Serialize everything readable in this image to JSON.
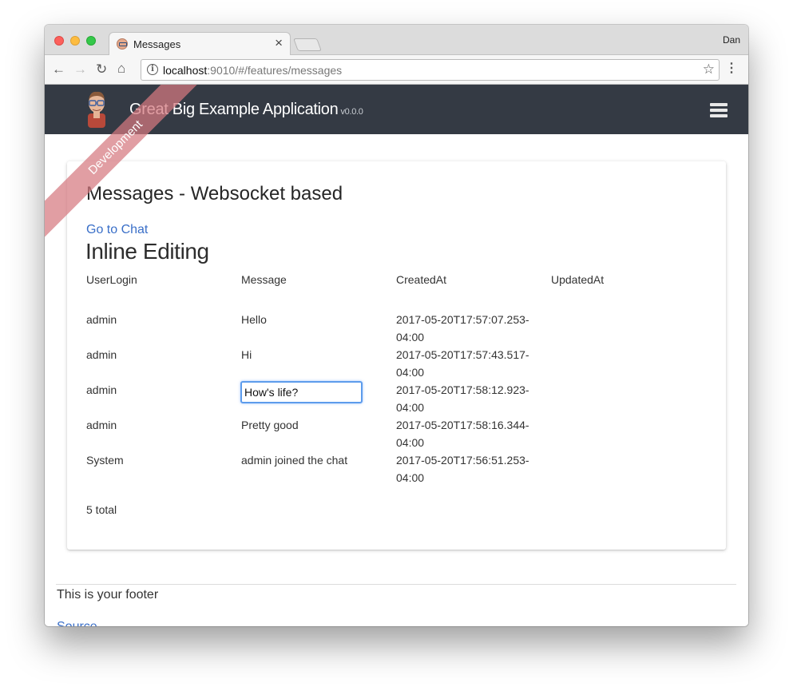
{
  "browser": {
    "tab_title": "Messages",
    "tab_close": "×",
    "profile_name": "Dan",
    "url_host": "localhost",
    "url_rest": ":9010/#/features/messages",
    "back": "←",
    "forward": "→",
    "reload": "↻",
    "home": "⌂",
    "star": "☆",
    "menu": "⋮",
    "info": "i"
  },
  "app": {
    "brand": "Great Big Example Application",
    "version": "v0.0.0",
    "ribbon": "Development"
  },
  "page": {
    "title": "Messages - Websocket based",
    "chat_link": "Go to Chat",
    "section_heading": "Inline Editing",
    "columns": [
      "UserLogin",
      "Message",
      "CreatedAt",
      "UpdatedAt"
    ],
    "rows": [
      {
        "user": "admin",
        "message": "Hello",
        "created": "2017-05-20T17:57:07.253-04:00",
        "updated": ""
      },
      {
        "user": "admin",
        "message": "Hi",
        "created": "2017-05-20T17:57:43.517-04:00",
        "updated": ""
      },
      {
        "user": "admin",
        "message": "How's life?",
        "created": "2017-05-20T17:58:12.923-04:00",
        "updated": "",
        "editing": true
      },
      {
        "user": "admin",
        "message": "Pretty good",
        "created": "2017-05-20T17:58:16.344-04:00",
        "updated": ""
      },
      {
        "user": "System",
        "message": "admin joined the chat",
        "created": "2017-05-20T17:56:51.253-04:00",
        "updated": ""
      }
    ],
    "total_label": "5 total"
  },
  "footer": {
    "text": "This is your footer",
    "link": "Source"
  },
  "colors": {
    "navbar": "#343a44",
    "link": "#3a6fc8",
    "ribbon": "#d67880",
    "focus_ring": "#5d9cec"
  },
  "icons": [
    "close-icon",
    "back-arrow-icon",
    "forward-arrow-icon",
    "reload-icon",
    "home-icon",
    "info-icon",
    "star-icon",
    "menu-dots-icon",
    "hamburger-icon",
    "avatar"
  ]
}
